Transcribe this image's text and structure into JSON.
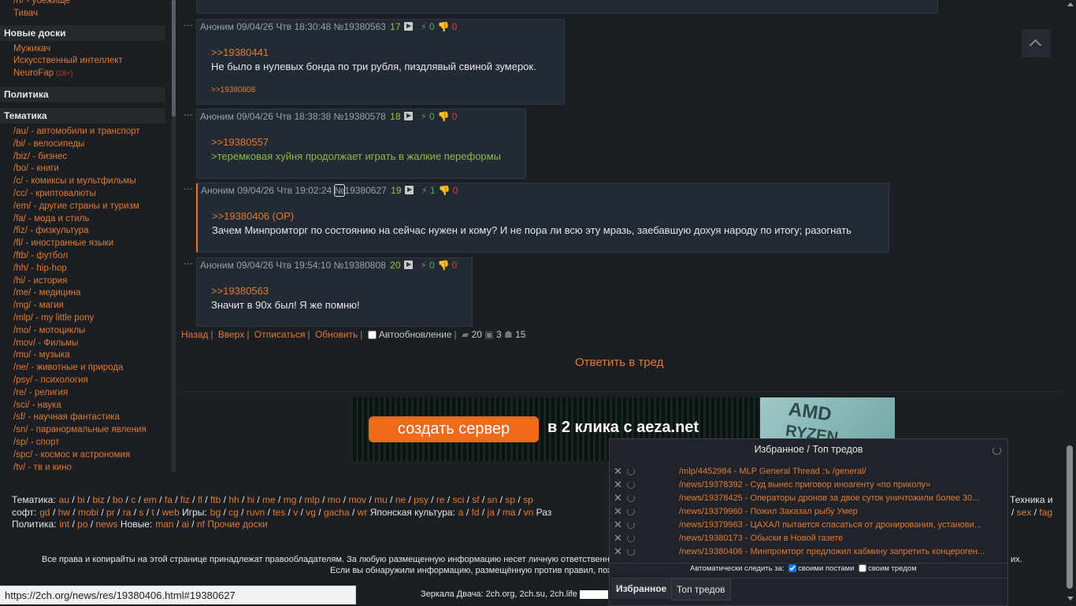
{
  "sidebar": {
    "top_items": [
      "/rf/ - убежище",
      "Тивач"
    ],
    "sections": [
      {
        "title": "Новые доски",
        "items": [
          {
            "label": "Мужикач"
          },
          {
            "label": "Искусственный интеллект"
          },
          {
            "label": "NeuroFap",
            "tag": "(18+)"
          }
        ]
      },
      {
        "title": "Политика",
        "items": []
      },
      {
        "title": "Тематика",
        "items": [
          {
            "label": "/au/ - автомобили и транспорт"
          },
          {
            "label": "/bi/ - велосипеды"
          },
          {
            "label": "/biz/ - бизнес"
          },
          {
            "label": "/bo/ - книги"
          },
          {
            "label": "/c/ - комиксы и мультфильмы"
          },
          {
            "label": "/cc/ - криптовалюты"
          },
          {
            "label": "/em/ - другие страны и туризм"
          },
          {
            "label": "/fa/ - мода и стиль"
          },
          {
            "label": "/fiz/ - физкультура"
          },
          {
            "label": "/fl/ - иностранные языки"
          },
          {
            "label": "/ftb/ - футбол"
          },
          {
            "label": "/hh/ - hip-hop"
          },
          {
            "label": "/hi/ - история"
          },
          {
            "label": "/me/ - медицина"
          },
          {
            "label": "/mg/ - магия"
          },
          {
            "label": "/mlp/ - my little pony"
          },
          {
            "label": "/mo/ - мотоциклы"
          },
          {
            "label": "/mov/ - Фильмы"
          },
          {
            "label": "/mu/ - музыка"
          },
          {
            "label": "/ne/ - животные и природа"
          },
          {
            "label": "/psy/ - психология"
          },
          {
            "label": "/re/ - религия"
          },
          {
            "label": "/sci/ - наука"
          },
          {
            "label": "/sf/ - научная фантастика"
          },
          {
            "label": "/sn/ - паранормальные явления"
          },
          {
            "label": "/sp/ - спорт"
          },
          {
            "label": "/spc/ - космос и астрономия"
          },
          {
            "label": "/tv/ - тв и кино"
          }
        ]
      }
    ]
  },
  "posts": [
    {
      "author": "Аноним",
      "date": "09/04/26 Чтв 18:30:48",
      "num": "№19380563",
      "count": "17",
      "likes": "0",
      "dislikes": "0",
      "lines": [
        {
          "text": ">>19380441",
          "kind": "ref"
        },
        {
          "text": "Не было в нулевых бонда по три рубля, пиздлявый свиной зумерок.",
          "kind": "text"
        }
      ],
      "replies": ">>19380808"
    },
    {
      "author": "Аноним",
      "date": "09/04/26 Чтв 18:38:38",
      "num": "№19380578",
      "count": "18",
      "likes": "0",
      "dislikes": "0",
      "lines": [
        {
          "text": ">>19380557",
          "kind": "ref"
        },
        {
          "text": ">теремковая хуйня продолжает играть в жалкие переформы",
          "kind": "green"
        }
      ],
      "replies": ""
    },
    {
      "author": "Аноним",
      "date": "09/04/26 Чтв 19:02:24",
      "num_prefix": "№",
      "num": "19380627",
      "count": "19",
      "likes": "1",
      "dislikes": "0",
      "lines": [
        {
          "text": ">>19380406 (OP)",
          "kind": "ref"
        },
        {
          "text": "Зачем Минпромторг по состоянию на сейчас нужен и кому? И не пора ли всю эту мразь, заебавшую дохуя народу по итогу; разогнать",
          "kind": "text"
        }
      ],
      "replies": ""
    },
    {
      "author": "Аноним",
      "date": "09/04/26 Чтв 19:54:10",
      "num": "№19380808",
      "count": "20",
      "likes": "0",
      "dislikes": "0",
      "lines": [
        {
          "text": ">>19380563",
          "kind": "ref"
        },
        {
          "text": "Значит в 90х был! Я же помню!",
          "kind": "text"
        }
      ],
      "replies": ""
    }
  ],
  "nav": {
    "back": "Назад",
    "top": "Вверх",
    "unsubscribe": "Отписаться",
    "refresh": "Обновить",
    "autoupdate": "Автообновление",
    "posts_count": "20",
    "files_count": "3",
    "posters_count": "15"
  },
  "reply_button": "Ответить в тред",
  "banner": {
    "button": "создать сервер",
    "tagline": "в 2 клика с aeza.net",
    "brand1": "AMD",
    "brand2": "RYZEN"
  },
  "footer": {
    "line1_label": "Тематика:",
    "line1": [
      "au",
      "bi",
      "biz",
      "bo",
      "c",
      "em",
      "fa",
      "fiz",
      "fl",
      "ftb",
      "hh",
      "hi",
      "me",
      "mg",
      "mlp",
      "mo",
      "mov",
      "mu",
      "ne",
      "psy",
      "re",
      "sci",
      "sf",
      "sn",
      "sp",
      "sp"
    ],
    "line1_right": "Техника и",
    "line2_label": "софт:",
    "line2": [
      "gd",
      "hw",
      "mobi",
      "pr",
      "ra",
      "s",
      "t",
      "web"
    ],
    "line2_games_label": "Игры:",
    "line2_games": [
      "bg",
      "cg",
      "ruvn",
      "tes",
      "v",
      "vg",
      "gacha",
      "wr"
    ],
    "line2_jp_label": "Японская культура:",
    "line2_jp": [
      "a",
      "fd",
      "ja",
      "ma",
      "vn"
    ],
    "line2_tail": "Раз",
    "line2_right": [
      "sex",
      "fag"
    ],
    "line3_label": "Политика:",
    "line3": [
      "int",
      "po",
      "news"
    ],
    "line3_new_label": "Новые:",
    "line3_new": [
      "man",
      "ai",
      "nf"
    ],
    "line3_other": "Прочие доски",
    "rights1": "Все права и копирайты на этой странице принадлежат правообладателям. За любую размещенную информацию несет личную ответственност",
    "rights1_end": "их.",
    "rights2": "Если вы обнаружили информацию, размещённую против правил, пожа",
    "mirrors": "Зеркала Двача: 2ch.org, 2ch.su, 2ch.life"
  },
  "statusbar": "https://2ch.org/news/res/19380406.html#19380627",
  "favorites": {
    "title": "Избранное / Топ тредов",
    "items": [
      "/mlp/4452984 - MLP General Thread :ъ /general/",
      "/news/19378392 - Суд вынес приговор иноагенту «по приколу»",
      "/news/19378425 - Операторы дронов за двое суток уничтожили более 30...",
      "/news/19379960 - Пожил Заказал рыбу Умер",
      "/news/19379963 - ЦАХАЛ пытается спасаться от дронирования, установи...",
      "/news/19380173 - Обыски в Новой газете",
      "/news/19380406 - Минпромторг предложил кабмину запретить концероген..."
    ],
    "auto_label": "Автоматически следить за:",
    "opt1": "своими постами",
    "opt2": "своим тредом",
    "tab1": "Избранное",
    "tab2": "Топ тредов"
  }
}
